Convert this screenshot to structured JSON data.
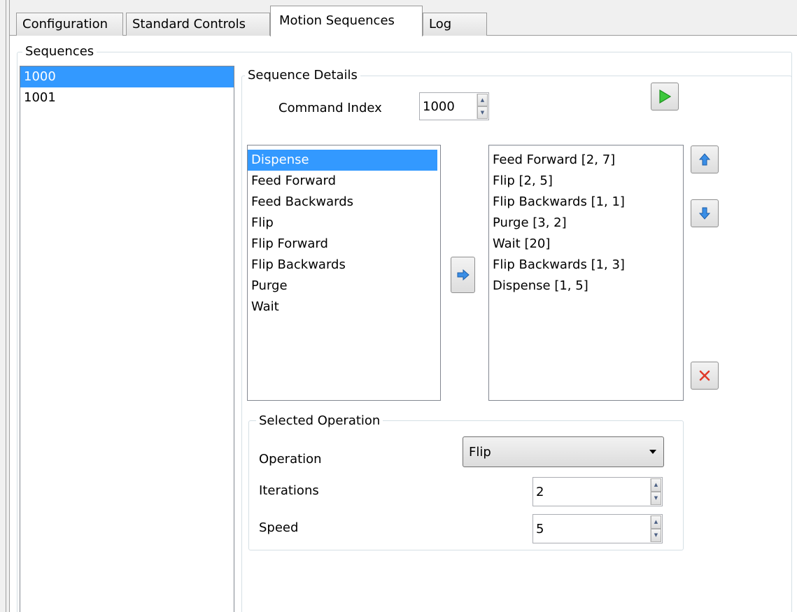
{
  "tabs": [
    {
      "label": "Configuration"
    },
    {
      "label": "Standard Controls"
    },
    {
      "label": "Motion Sequences"
    },
    {
      "label": "Log"
    }
  ],
  "sequences": {
    "title": "Sequences",
    "items": [
      "1000",
      "1001"
    ],
    "selected_index": 0
  },
  "details": {
    "title": "Sequence Details",
    "command_index_label": "Command Index",
    "command_index_value": "1000",
    "run_icon": "play-icon"
  },
  "operations": {
    "items": [
      "Dispense",
      "Feed Forward",
      "Feed Backwards",
      "Flip",
      "Flip Forward",
      "Flip Backwards",
      "Purge",
      "Wait"
    ],
    "selected_index": 0
  },
  "steps": {
    "items": [
      "Feed Forward [2, 7]",
      "Flip [2, 5]",
      "Flip Backwards [1, 1]",
      "Purge [3, 2]",
      "Wait [20]",
      "Flip Backwards [1, 3]",
      "Dispense [1, 5]"
    ]
  },
  "buttons": {
    "add_icon": "arrow-right-icon",
    "up_icon": "arrow-up-icon",
    "down_icon": "arrow-down-icon",
    "delete_icon": "delete-icon"
  },
  "selected_operation": {
    "title": "Selected Operation",
    "operation_label": "Operation",
    "operation_value": "Flip",
    "iterations_label": "Iterations",
    "iterations_value": "2",
    "speed_label": "Speed",
    "speed_value": "5"
  },
  "colors": {
    "selection": "#3399ff",
    "play": "#3cc83c",
    "arrow": "#3a8ee6",
    "delete": "#e03a2a"
  }
}
